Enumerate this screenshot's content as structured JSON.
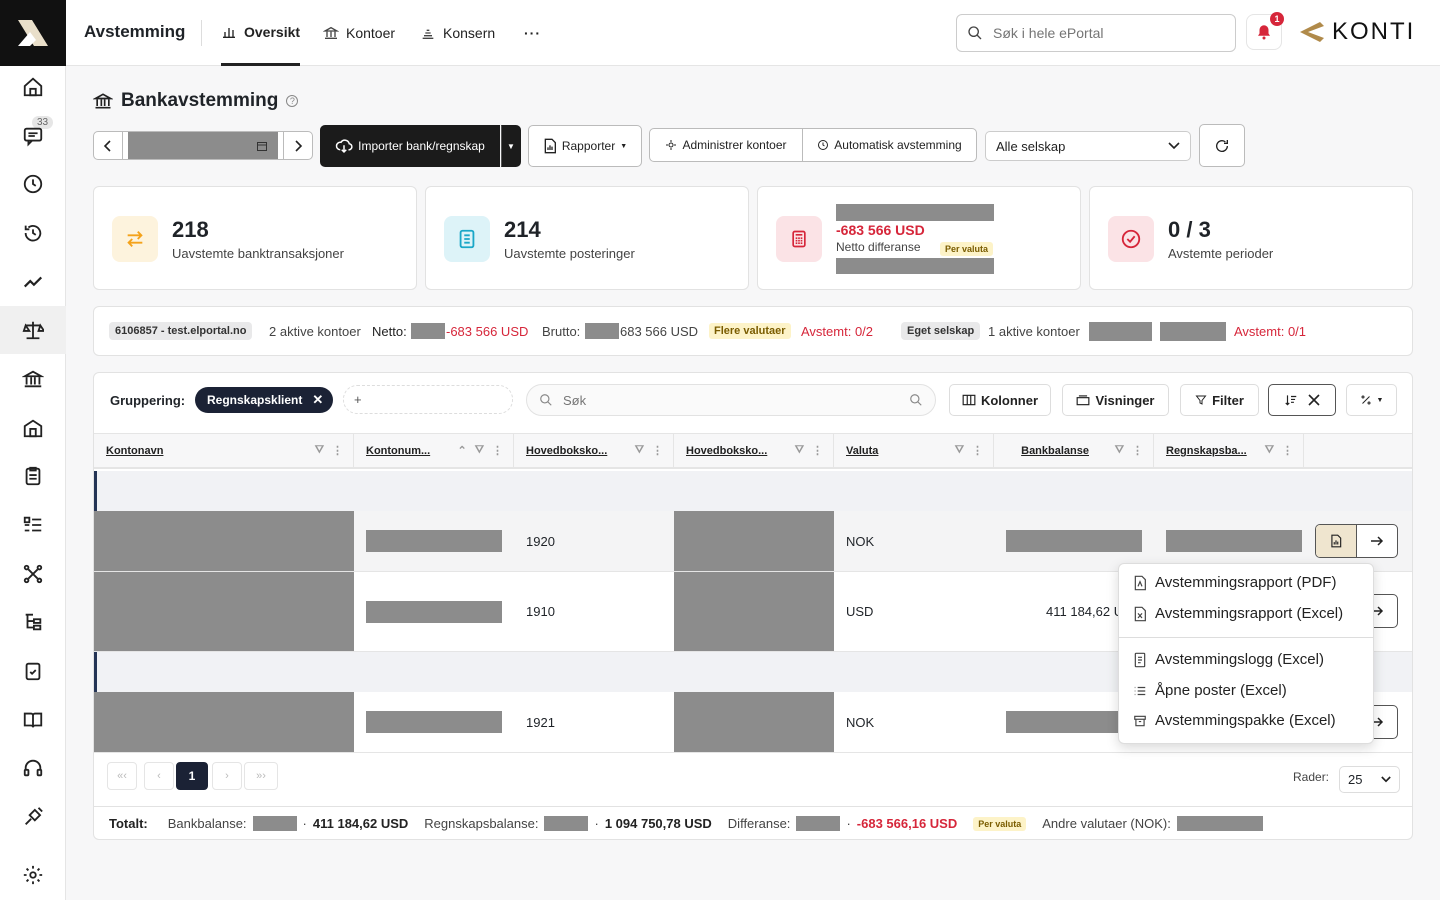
{
  "app": {
    "title": "Avstemming",
    "brand": "KONTI"
  },
  "nav_tabs": [
    {
      "label": "Oversikt",
      "active": true
    },
    {
      "label": "Kontoer",
      "active": false
    },
    {
      "label": "Konsern",
      "active": false
    },
    {
      "label": "···",
      "active": false
    }
  ],
  "search": {
    "placeholder": "Søk i hele ePortal"
  },
  "notifications": {
    "count": "1"
  },
  "sidebar": {
    "badge": "33",
    "items": [
      "home-icon",
      "chat-icon",
      "clock-icon",
      "history-icon",
      "trend-icon",
      "balance-scale-icon",
      "bank-icon",
      "building-icon",
      "clipboard-icon",
      "list-icon",
      "network-icon",
      "tree-icon",
      "checklist-icon",
      "book-icon",
      "headset-icon",
      "satellite-icon",
      "settings-icon"
    ]
  },
  "page": {
    "title": "Bankavstemming",
    "help": "?"
  },
  "toolbar": {
    "import_label": "Importer bank/regnskap",
    "reports_label": "Rapporter",
    "manage_accounts_label": "Administrer kontoer",
    "auto_reconcile_label": "Automatisk avstemming",
    "company_select": "Alle selskap"
  },
  "cards": [
    {
      "value": "218",
      "label": "Uavstemte banktransaksjoner",
      "icon": "transfer-arrows-icon",
      "color": "#f4a21a"
    },
    {
      "value": "214",
      "label": "Uavstemte posteringer",
      "icon": "document-list-icon",
      "color": "#1aa7c8"
    },
    {
      "value": "-683 566 USD",
      "label": "Netto differanse",
      "badge": "Per valuta",
      "icon": "calculator-icon",
      "color": "#d6263a"
    },
    {
      "value": "0 / 3",
      "label": "Avstemte perioder",
      "icon": "check-circle-icon",
      "color": "#d6263a"
    }
  ],
  "summary": {
    "company1": "6106857 - test.elportal.no",
    "active_accounts1": "2 aktive kontoer",
    "netto_label": "Netto:",
    "netto_value": "-683 566 USD",
    "brutto_label": "Brutto:",
    "brutto_value": "683 566 USD",
    "multi_currency": "Flere valutaer",
    "reconciled1": "Avstemt: 0/2",
    "company2": "Eget selskap",
    "active_accounts2": "1 aktive kontoer",
    "reconciled2": "Avstemt: 0/1"
  },
  "grid": {
    "grouping_label": "Gruppering:",
    "group_chip": "Regnskapsklient",
    "add_group": "+",
    "search_placeholder": "Søk",
    "columns_btn": "Kolonner",
    "views_btn": "Visninger",
    "filter_btn": "Filter",
    "headers": [
      "Kontonavn",
      "Kontonum...",
      "Hovedboksko...",
      "Hovedboksko...",
      "Valuta",
      "Bankbalanse",
      "Regnskapsba..."
    ],
    "rows": [
      {
        "gl_account": "1920",
        "currency": "NOK",
        "bank_balance": ""
      },
      {
        "gl_account": "1910",
        "currency": "USD",
        "bank_balance": "411 184,62 U"
      },
      {
        "gl_account": "1921",
        "currency": "NOK",
        "bank_balance": ""
      }
    ],
    "pagination": {
      "first": "«‹",
      "prev": "‹",
      "page": "1",
      "next": "›",
      "last": "»›"
    },
    "rows_label": "Rader:",
    "rows_per_page": "25"
  },
  "menu": {
    "items": [
      {
        "label": "Avstemmingsrapport (PDF)",
        "icon": "pdf-file-icon"
      },
      {
        "label": "Avstemmingsrapport (Excel)",
        "icon": "excel-file-icon"
      },
      {
        "label": "Avstemmingslogg (Excel)",
        "icon": "log-file-icon"
      },
      {
        "label": "Åpne poster (Excel)",
        "icon": "list-lines-icon"
      },
      {
        "label": "Avstemmingspakke (Excel)",
        "icon": "archive-box-icon"
      }
    ]
  },
  "totals": {
    "label": "Totalt:",
    "bank_label": "Bankbalanse:",
    "bank_value": "411 184,62 USD",
    "ledger_label": "Regnskapsbalanse:",
    "ledger_value": "1 094 750,78 USD",
    "diff_label": "Differanse:",
    "diff_value": "-683 566,16 USD",
    "per_currency": "Per valuta",
    "other_label": "Andre valutaer (NOK):"
  }
}
